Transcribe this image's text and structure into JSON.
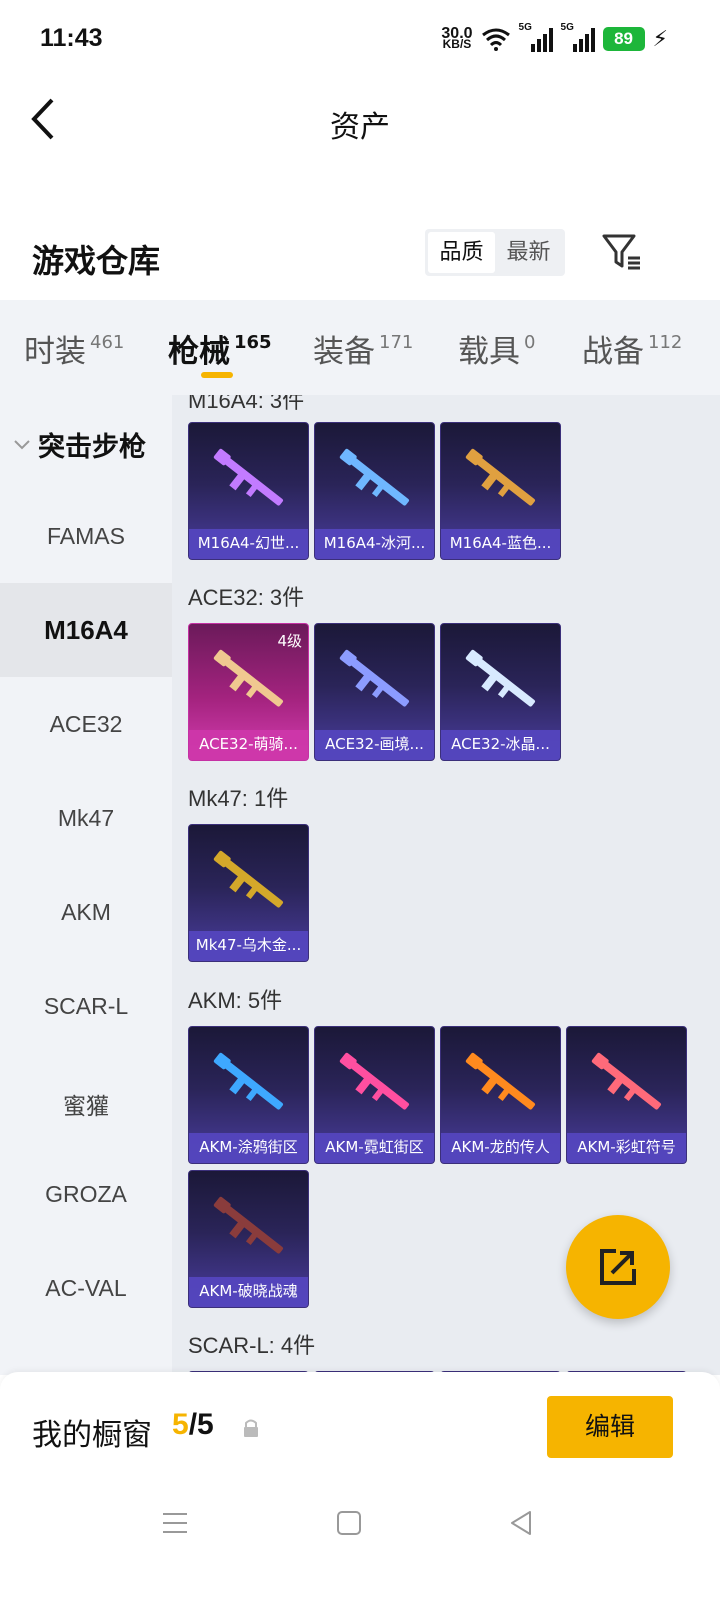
{
  "status_bar": {
    "time": "11:43",
    "net_speed_value": "30.0",
    "net_speed_unit": "KB/S",
    "signal_tag": "5G",
    "battery": "89"
  },
  "header": {
    "title": "资产"
  },
  "warehouse": {
    "title": "游戏仓库",
    "sort_options": [
      "品质",
      "最新"
    ],
    "sort_selected": "品质"
  },
  "tabs": [
    {
      "label": "时装",
      "count": "461"
    },
    {
      "label": "枪械",
      "count": "165",
      "active": true
    },
    {
      "label": "装备",
      "count": "171"
    },
    {
      "label": "载具",
      "count": "0"
    },
    {
      "label": "战备",
      "count": "112"
    }
  ],
  "sidebar": {
    "group": "突击步枪",
    "items": [
      "FAMAS",
      "M16A4",
      "ACE32",
      "Mk47",
      "AKM",
      "SCAR-L",
      "蜜獾",
      "GROZA",
      "AC-VAL"
    ],
    "active": "M16A4"
  },
  "sections": [
    {
      "title": "M16A4: 3件",
      "items": [
        {
          "name": "M16A4-幻世...",
          "style": "purple",
          "gun_color": "#c27bff"
        },
        {
          "name": "M16A4-冰河...",
          "style": "purple",
          "gun_color": "#6fb7ff"
        },
        {
          "name": "M16A4-蓝色...",
          "style": "purple",
          "gun_color": "#e0a040"
        }
      ]
    },
    {
      "title": "ACE32: 3件",
      "items": [
        {
          "name": "ACE32-萌骑...",
          "style": "pink",
          "level": "4级",
          "gun_color": "#f0c890"
        },
        {
          "name": "ACE32-画境...",
          "style": "purple",
          "gun_color": "#8c9cff"
        },
        {
          "name": "ACE32-冰晶...",
          "style": "purple",
          "gun_color": "#d8eaff"
        }
      ]
    },
    {
      "title": "Mk47: 1件",
      "items": [
        {
          "name": "Mk47-乌木金...",
          "style": "purple",
          "gun_color": "#d4a82a"
        }
      ]
    },
    {
      "title": "AKM: 5件",
      "items": [
        {
          "name": "AKM-涂鸦街区",
          "style": "purple",
          "gun_color": "#3ea8ff"
        },
        {
          "name": "AKM-霓虹街区",
          "style": "purple",
          "gun_color": "#ff4fa0"
        },
        {
          "name": "AKM-龙的传人",
          "style": "purple",
          "gun_color": "#ff8a1e"
        },
        {
          "name": "AKM-彩虹符号",
          "style": "purple",
          "gun_color": "#ff6a7a"
        },
        {
          "name": "AKM-破晓战魂",
          "style": "purple",
          "gun_color": "#8a3c3c"
        }
      ]
    },
    {
      "title": "SCAR-L: 4件",
      "items": []
    }
  ],
  "showcase": {
    "label": "我的橱窗",
    "current": "5",
    "total": "/5",
    "edit_label": "编辑"
  }
}
